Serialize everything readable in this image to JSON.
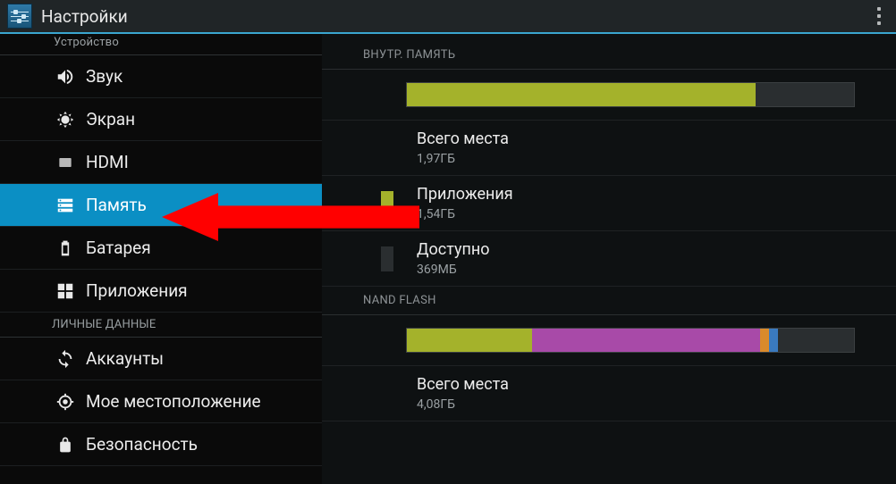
{
  "app": {
    "title": "Настройки"
  },
  "sidebar": {
    "section_device": "Устройство",
    "section_personal": "ЛИЧНЫЕ ДАННЫЕ",
    "items": {
      "sound": "Звук",
      "display": "Экран",
      "hdmi": "HDMI",
      "storage": "Память",
      "battery": "Батарея",
      "apps": "Приложения",
      "accounts": "Аккаунты",
      "location": "Мое местоположение",
      "security": "Безопасность"
    }
  },
  "storage": {
    "internal_header": "ВНУТР. ПАМЯТЬ",
    "nand_header": "NAND FLASH",
    "rows": {
      "total": {
        "label": "Всего места",
        "value": "1,97ГБ"
      },
      "apps": {
        "label": "Приложения",
        "value": "1,54ГБ"
      },
      "available": {
        "label": "Доступно",
        "value": "369МБ"
      },
      "nand_total": {
        "label": "Всего места",
        "value": "4,08ГБ"
      }
    },
    "colors": {
      "apps": "#a4b22b",
      "free": "#2a2e30",
      "nand_a": "#a4b22b",
      "nand_b": "#a84aa8",
      "nand_c": "#d98a2b",
      "nand_d": "#3a7abf"
    }
  },
  "chart_data": [
    {
      "type": "bar",
      "title": "ВНУТР. ПАМЯТЬ",
      "categories": [
        "Приложения",
        "Доступно"
      ],
      "values": [
        1.54,
        0.369
      ],
      "total": 1.97,
      "unit": "ГБ",
      "colors": [
        "#a4b22b",
        "#2a2e30"
      ]
    },
    {
      "type": "bar",
      "title": "NAND FLASH",
      "total": 4.08,
      "unit": "ГБ",
      "series": [
        {
          "name": "seg1",
          "fraction": 0.28,
          "color": "#a4b22b"
        },
        {
          "name": "seg2",
          "fraction": 0.51,
          "color": "#a84aa8"
        },
        {
          "name": "seg3",
          "fraction": 0.02,
          "color": "#d98a2b"
        },
        {
          "name": "seg4",
          "fraction": 0.02,
          "color": "#3a7abf"
        },
        {
          "name": "free",
          "fraction": 0.17,
          "color": "#2a2e30"
        }
      ]
    }
  ]
}
